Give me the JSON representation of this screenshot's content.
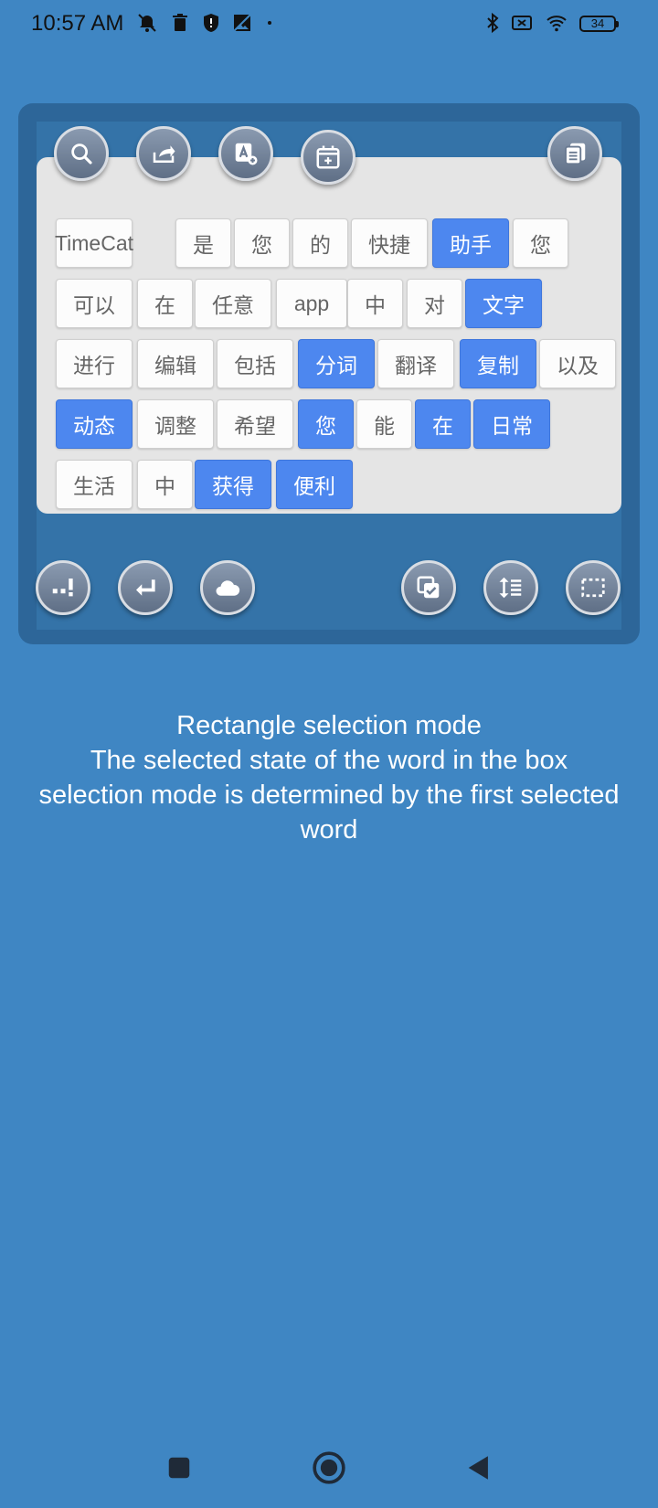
{
  "status": {
    "time": "10:57 AM",
    "battery": "34",
    "left_icons": [
      "alarm-off-icon",
      "trash-icon",
      "shield-icon",
      "image-off-icon",
      "dot-icon"
    ],
    "right_icons": [
      "bluetooth-icon",
      "sim-off-icon",
      "wifi-icon"
    ]
  },
  "toolbar": {
    "top_buttons": [
      "search-icon",
      "share-icon",
      "translate-icon",
      "calendar-add-icon",
      "copy-multiple-icon"
    ],
    "bottom_buttons": [
      "punctuation-icon",
      "enter-icon",
      "cloud-icon",
      "select-all-icon",
      "line-spacing-icon",
      "rectangle-select-icon"
    ]
  },
  "words": [
    {
      "text": "TimeCat",
      "selected": false
    },
    {
      "text": "是",
      "selected": false
    },
    {
      "text": "您",
      "selected": false
    },
    {
      "text": "的",
      "selected": false
    },
    {
      "text": "快捷",
      "selected": false
    },
    {
      "text": "助手",
      "selected": true
    },
    {
      "text": "您",
      "selected": false
    },
    {
      "text": "可以",
      "selected": false
    },
    {
      "text": "在",
      "selected": false
    },
    {
      "text": "任意",
      "selected": false
    },
    {
      "text": "app",
      "selected": false
    },
    {
      "text": "中",
      "selected": false
    },
    {
      "text": "对",
      "selected": false
    },
    {
      "text": "文字",
      "selected": true
    },
    {
      "text": "进行",
      "selected": false
    },
    {
      "text": "编辑",
      "selected": false
    },
    {
      "text": "包括",
      "selected": false
    },
    {
      "text": "分词",
      "selected": true
    },
    {
      "text": "翻译",
      "selected": false
    },
    {
      "text": "复制",
      "selected": true
    },
    {
      "text": "以及",
      "selected": false
    },
    {
      "text": "动态",
      "selected": true
    },
    {
      "text": "调整",
      "selected": false
    },
    {
      "text": "希望",
      "selected": false
    },
    {
      "text": "您",
      "selected": true
    },
    {
      "text": "能",
      "selected": false
    },
    {
      "text": "在",
      "selected": true
    },
    {
      "text": "日常",
      "selected": true
    },
    {
      "text": "生活",
      "selected": false
    },
    {
      "text": "中",
      "selected": false
    },
    {
      "text": "获得",
      "selected": true
    },
    {
      "text": "便利",
      "selected": true
    }
  ],
  "caption": {
    "line1": "Rectangle selection mode",
    "line2": "The selected state of the word in the box",
    "line3": "selection mode is determined by the first selected",
    "line4": "word"
  },
  "colors": {
    "background": "#3f86c3",
    "chip_selected": "#4d87ef",
    "chip_default": "#fcfcfc"
  },
  "navbar": [
    "recents-button",
    "home-button",
    "back-button"
  ]
}
